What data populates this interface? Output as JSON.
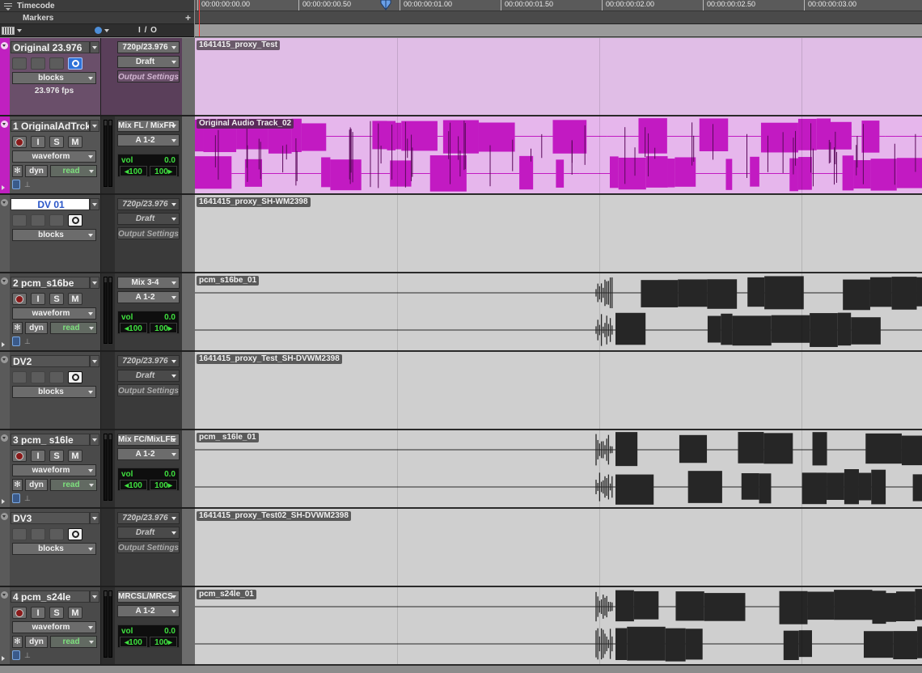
{
  "ruler": {
    "timecode_label": "Timecode",
    "markers_label": "Markers",
    "markers_add": "+",
    "ticks": [
      {
        "label": "00:00:00:00.00"
      },
      {
        "label": "00:00:00:00.50"
      },
      {
        "label": "00:00:00:01.00"
      },
      {
        "label": "00:00:00:01.50"
      },
      {
        "label": "00:00:00:02.00"
      },
      {
        "label": "00:00:00:02.50"
      },
      {
        "label": "00:00:00:03.00"
      }
    ]
  },
  "header": {
    "io_label": "I / O"
  },
  "colors": {
    "video_track_bg": "#e0bde6",
    "audio_purple": "#c020c0",
    "audio_dark": "#262626",
    "meter_green": "#3fe03f"
  },
  "tracks": [
    {
      "type": "video-main",
      "name": "Original 23.976",
      "view": "blocks",
      "fps": "23.976 fps",
      "io_format": "720p/23.976",
      "io_quality": "Draft",
      "output_settings": "Output Settings",
      "clip_name": "1641415_proxy_Test"
    },
    {
      "type": "audio",
      "name": "1 OriginalAdTrck",
      "view": "waveform",
      "auto_dyn": "dyn",
      "auto_mode": "read",
      "io_input": "Mix FL / MixFR",
      "io_output": "A 1-2",
      "vol_label": "vol",
      "vol_value": "0.0",
      "pan_left": "◂100",
      "pan_right": "100▸",
      "clip_name": "Original Audio Track_02"
    },
    {
      "type": "video",
      "name": "DV 01",
      "view": "blocks",
      "io_format": "720p/23.976",
      "io_quality": "Draft",
      "output_settings": "Output Settings",
      "clip_name": "1641415_proxy_SH-WM2398"
    },
    {
      "type": "audio",
      "name": "2   pcm_s16be",
      "view": "waveform",
      "auto_dyn": "dyn",
      "auto_mode": "read",
      "io_input": "Mix 3-4",
      "io_output": "A 1-2",
      "vol_label": "vol",
      "vol_value": "0.0",
      "pan_left": "◂100",
      "pan_right": "100▸",
      "clip_name": "pcm_s16be_01"
    },
    {
      "type": "video",
      "name": "DV2",
      "view": "blocks",
      "io_format": "720p/23.976",
      "io_quality": "Draft",
      "output_settings": "Output Settings",
      "clip_name": "1641415_proxy_Test_SH-DVWM2398"
    },
    {
      "type": "audio",
      "name": "3   pcm_ s16le",
      "view": "waveform",
      "auto_dyn": "dyn",
      "auto_mode": "read",
      "io_input": "Mix FC/MixLFE",
      "io_output": "A 1-2",
      "vol_label": "vol",
      "vol_value": "0.0",
      "pan_left": "◂100",
      "pan_right": "100▸",
      "clip_name": "pcm_ s16le_01"
    },
    {
      "type": "video",
      "name": "DV3",
      "view": "blocks",
      "io_format": "720p/23.976",
      "io_quality": "Draft",
      "output_settings": "Output Settings",
      "clip_name": "1641415_proxy_Test02_SH-DVWM2398"
    },
    {
      "type": "audio",
      "name": "4   pcm_s24le",
      "view": "waveform",
      "auto_dyn": "dyn",
      "auto_mode": "read",
      "io_input": "MRCSL/MRCS",
      "io_output": "A 1-2",
      "vol_label": "vol",
      "vol_value": "0.0",
      "pan_left": "◂100",
      "pan_right": "100▸",
      "clip_name": "pcm_s24le_01"
    }
  ],
  "buttons": {
    "input": "I",
    "solo": "S",
    "mute": "M"
  },
  "icons": {
    "record": "record-icon",
    "online": "online-icon",
    "clock": "timebase-icon",
    "plugin": "plugin-icon",
    "playhead": "playhead-marker-icon"
  }
}
